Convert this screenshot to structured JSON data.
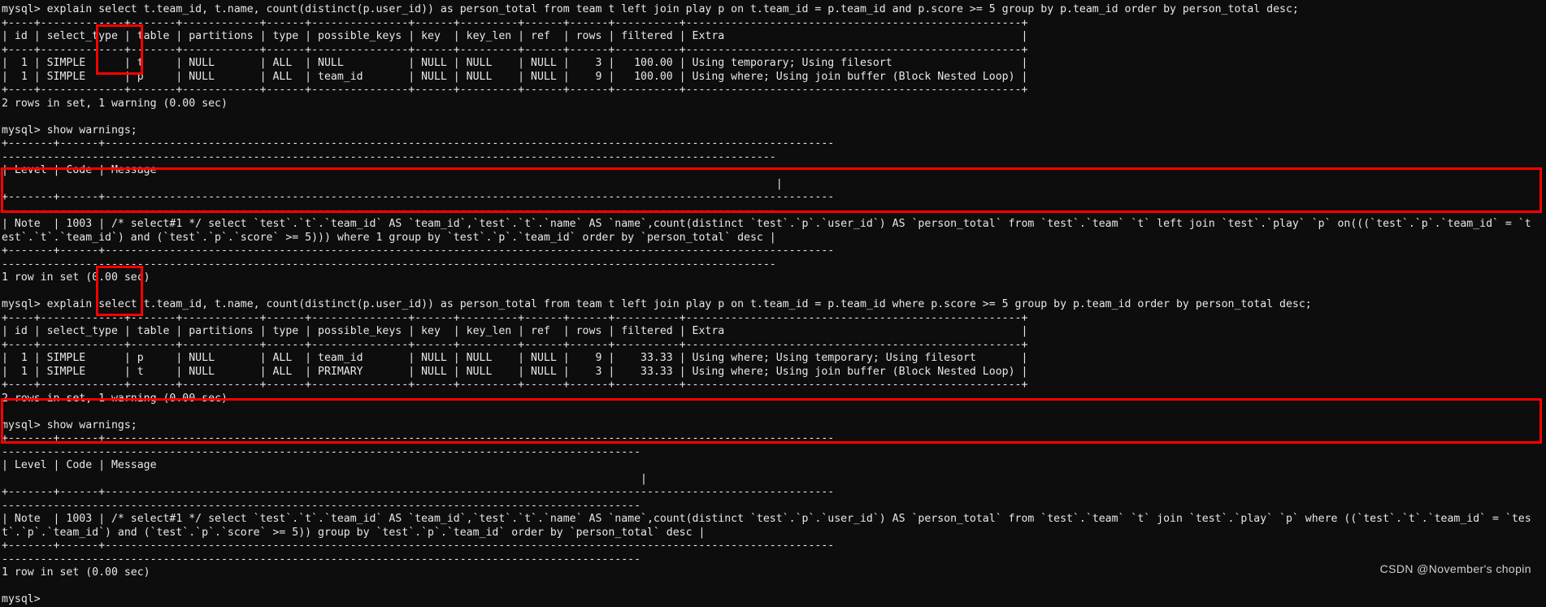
{
  "terminal": {
    "prompt": "mysql>",
    "watermark": "CSDN @November's  chopin",
    "accent_color": "#ff0000",
    "background_color": "#0d0d0d",
    "foreground_color": "#e8e8e8",
    "lines": [
      "mysql> explain select t.team_id, t.name, count(distinct(p.user_id)) as person_total from team t left join play p on t.team_id = p.team_id and p.score >= 5 group by p.team_id order by person_total desc;",
      "+----+-------------+-------+------------+------+---------------+------+---------+------+------+----------+----------------------------------------------------+",
      "| id | select_type | table | partitions | type | possible_keys | key  | key_len | ref  | rows | filtered | Extra                                              |",
      "+----+-------------+-------+------------+------+---------------+------+---------+------+------+----------+----------------------------------------------------+",
      "|  1 | SIMPLE      | t     | NULL       | ALL  | NULL          | NULL | NULL    | NULL |    3 |   100.00 | Using temporary; Using filesort                    |",
      "|  1 | SIMPLE      | p     | NULL       | ALL  | team_id       | NULL | NULL    | NULL |    9 |   100.00 | Using where; Using join buffer (Block Nested Loop) |",
      "+----+-------------+-------+------------+------+---------------+------+---------+------+------+----------+----------------------------------------------------+",
      "2 rows in set, 1 warning (0.00 sec)",
      "",
      "mysql> show warnings;",
      "+-------+------+-----------------------------------------------------------------------------------------------------------------",
      "------------------------------------------------------------------------------------------------------------------------",
      "| Level | Code | Message                                                                                                         ",
      "                                                                                                                        |",
      "+-------+------+-----------------------------------------------------------------------------------------------------------------",
      "------------------------------------------------------------------------------------------------------------------------",
      "| Note  | 1003 | /* select#1 */ select `test`.`t`.`team_id` AS `team_id`,`test`.`t`.`name` AS `name`,count(distinct `test`.`p`.`user_id`) AS `person_total` from `test`.`team` `t` left join `test`.`play` `p` on(((`test`.`p`.`team_id` = `t",
      "est`.`t`.`team_id`) and (`test`.`p`.`score` >= 5))) where 1 group by `test`.`p`.`team_id` order by `person_total` desc |",
      "+-------+------+-----------------------------------------------------------------------------------------------------------------",
      "------------------------------------------------------------------------------------------------------------------------",
      "1 row in set (0.00 sec)",
      "",
      "mysql> explain select t.team_id, t.name, count(distinct(p.user_id)) as person_total from team t left join play p on t.team_id = p.team_id where p.score >= 5 group by p.team_id order by person_total desc;",
      "+----+-------------+-------+------------+------+---------------+------+---------+------+------+----------+----------------------------------------------------+",
      "| id | select_type | table | partitions | type | possible_keys | key  | key_len | ref  | rows | filtered | Extra                                              |",
      "+----+-------------+-------+------------+------+---------------+------+---------+------+------+----------+----------------------------------------------------+",
      "|  1 | SIMPLE      | p     | NULL       | ALL  | team_id       | NULL | NULL    | NULL |    9 |    33.33 | Using where; Using temporary; Using filesort       |",
      "|  1 | SIMPLE      | t     | NULL       | ALL  | PRIMARY       | NULL | NULL    | NULL |    3 |    33.33 | Using where; Using join buffer (Block Nested Loop) |",
      "+----+-------------+-------+------------+------+---------------+------+---------+------+------+----------+----------------------------------------------------+",
      "2 rows in set, 1 warning (0.00 sec)",
      "",
      "mysql> show warnings;",
      "+-------+------+-----------------------------------------------------------------------------------------------------------------",
      "---------------------------------------------------------------------------------------------------",
      "| Level | Code | Message                                                                                                         ",
      "                                                                                                   |",
      "+-------+------+-----------------------------------------------------------------------------------------------------------------",
      "---------------------------------------------------------------------------------------------------",
      "| Note  | 1003 | /* select#1 */ select `test`.`t`.`team_id` AS `team_id`,`test`.`t`.`name` AS `name`,count(distinct `test`.`p`.`user_id`) AS `person_total` from `test`.`team` `t` join `test`.`play` `p` where ((`test`.`t`.`team_id` = `tes",
      "t`.`p`.`team_id`) and (`test`.`p`.`score` >= 5)) group by `test`.`p`.`team_id` order by `person_total` desc |",
      "+-------+------+-----------------------------------------------------------------------------------------------------------------",
      "---------------------------------------------------------------------------------------------------",
      "1 row in set (0.00 sec)",
      "",
      "mysql>"
    ]
  },
  "annotations": {
    "highlight_1_label": "table-column-highlight-first-explain",
    "highlight_2_label": "note-row-highlight-first-warning",
    "highlight_3_label": "table-column-highlight-second-explain",
    "highlight_4_label": "note-row-highlight-second-warning"
  },
  "explain_results": [
    {
      "query": "explain select t.team_id, t.name, count(distinct(p.user_id)) as person_total from team t left join play p on t.team_id = p.team_id and p.score >= 5 group by p.team_id order by person_total desc;",
      "columns": [
        "id",
        "select_type",
        "table",
        "partitions",
        "type",
        "possible_keys",
        "key",
        "key_len",
        "ref",
        "rows",
        "filtered",
        "Extra"
      ],
      "rows": [
        [
          "1",
          "SIMPLE",
          "t",
          "NULL",
          "ALL",
          "NULL",
          "NULL",
          "NULL",
          "NULL",
          "3",
          "100.00",
          "Using temporary; Using filesort"
        ],
        [
          "1",
          "SIMPLE",
          "p",
          "NULL",
          "ALL",
          "team_id",
          "NULL",
          "NULL",
          "NULL",
          "9",
          "100.00",
          "Using where; Using join buffer (Block Nested Loop)"
        ]
      ],
      "status": "2 rows in set, 1 warning (0.00 sec)",
      "warning": {
        "level": "Note",
        "code": "1003",
        "message": "/* select#1 */ select `test`.`t`.`team_id` AS `team_id`,`test`.`t`.`name` AS `name`,count(distinct `test`.`p`.`user_id`) AS `person_total` from `test`.`team` `t` left join `test`.`play` `p` on(((`test`.`p`.`team_id` = `test`.`t`.`team_id`) and (`test`.`p`.`score` >= 5))) where 1 group by `test`.`p`.`team_id` order by `person_total` desc",
        "status": "1 row in set (0.00 sec)"
      }
    },
    {
      "query": "explain select t.team_id, t.name, count(distinct(p.user_id)) as person_total from team t left join play p on t.team_id = p.team_id where p.score >= 5 group by p.team_id order by person_total desc;",
      "columns": [
        "id",
        "select_type",
        "table",
        "partitions",
        "type",
        "possible_keys",
        "key",
        "key_len",
        "ref",
        "rows",
        "filtered",
        "Extra"
      ],
      "rows": [
        [
          "1",
          "SIMPLE",
          "p",
          "NULL",
          "ALL",
          "team_id",
          "NULL",
          "NULL",
          "NULL",
          "9",
          "33.33",
          "Using where; Using temporary; Using filesort"
        ],
        [
          "1",
          "SIMPLE",
          "t",
          "NULL",
          "ALL",
          "PRIMARY",
          "NULL",
          "NULL",
          "NULL",
          "3",
          "33.33",
          "Using where; Using join buffer (Block Nested Loop)"
        ]
      ],
      "status": "2 rows in set, 1 warning (0.00 sec)",
      "warning": {
        "level": "Note",
        "code": "1003",
        "message": "/* select#1 */ select `test`.`t`.`team_id` AS `team_id`,`test`.`t`.`name` AS `name`,count(distinct `test`.`p`.`user_id`) AS `person_total` from `test`.`team` `t` join `test`.`play` `p` where ((`test`.`t`.`team_id` = `test`.`p`.`team_id`) and (`test`.`p`.`score` >= 5)) group by `test`.`p`.`team_id` order by `person_total` desc",
        "status": "1 row in set (0.00 sec)"
      }
    }
  ],
  "warnings_table": {
    "columns": [
      "Level",
      "Code",
      "Message"
    ]
  }
}
